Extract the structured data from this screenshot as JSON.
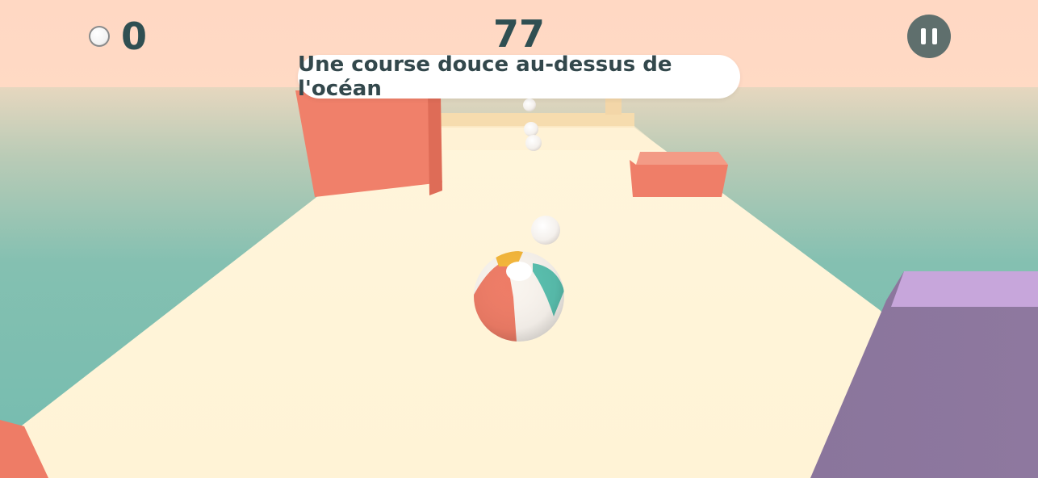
{
  "hud": {
    "coins": "0",
    "score": "77",
    "level_title": "Une course douce au-dessus de l'océan",
    "coin_icon": "coin-icon",
    "pause_icon": "pause-icon"
  },
  "colors": {
    "sky": "#ffd9c4",
    "ocean": "#7cc0b1",
    "track": "#fff4d8",
    "obstacle": "#f0806a",
    "purple_block": "#8c769d",
    "text": "#2f4f52"
  }
}
